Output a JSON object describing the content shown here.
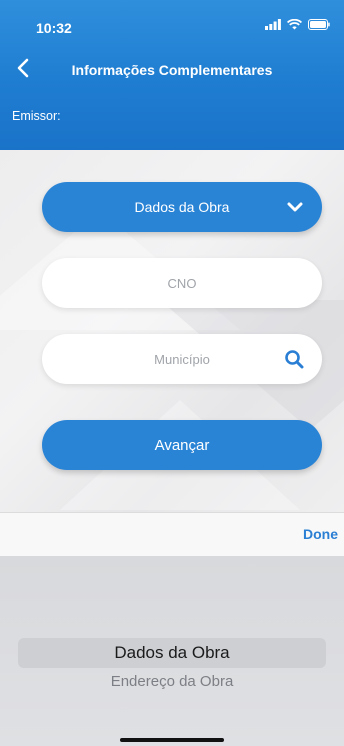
{
  "status": {
    "time": "10:32"
  },
  "nav": {
    "title": "Informações Complementares"
  },
  "emissor": {
    "label": "Emissor:"
  },
  "form": {
    "dropdown_value": "Dados da Obra",
    "cno_placeholder": "CNO",
    "municipio_placeholder": "Município",
    "advance_label": "Avançar"
  },
  "toolbar": {
    "done_label": "Done"
  },
  "picker": {
    "options": [
      "Dados da Obra",
      "Endereço da Obra"
    ]
  },
  "colors": {
    "primary": "#2a84d6",
    "done": "#2a7fd4"
  },
  "icons": [
    "back-chevron-icon",
    "chevron-down-icon",
    "search-icon",
    "signal-icon",
    "wifi-icon",
    "battery-icon"
  ]
}
